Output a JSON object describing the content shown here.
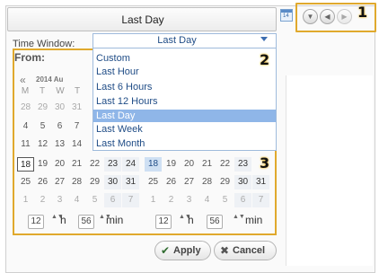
{
  "header": {
    "title": "Last Day"
  },
  "calendar_icon": {
    "label": "14"
  },
  "nav": {
    "dropdown_icon": "dropdown-icon",
    "prev_icon": "prev-icon",
    "next_icon": "next-icon"
  },
  "badges": {
    "b1": "1",
    "b2": "2",
    "b3": "3"
  },
  "time_window": {
    "label": "Time Window:",
    "value": "Last Day",
    "options": [
      "Custom",
      "Last Hour",
      "Last 6 Hours",
      "Last 12 Hours",
      "Last Day",
      "Last Week",
      "Last Month"
    ],
    "selected_index": 4
  },
  "from": {
    "label": "From:",
    "prev_label": "«",
    "month_label": "2014 Au",
    "day_names": [
      "M",
      "T",
      "W",
      "T"
    ],
    "weeks": [
      [
        "28",
        "29",
        "30",
        "31"
      ],
      [
        "4",
        "5",
        "6",
        "7"
      ],
      [
        "11",
        "12",
        "13",
        "14"
      ],
      [
        "18",
        "19",
        "20",
        "21",
        "22",
        "23",
        "24"
      ],
      [
        "25",
        "26",
        "27",
        "28",
        "29",
        "30",
        "31"
      ],
      [
        "1",
        "2",
        "3",
        "4",
        "5",
        "6",
        "7"
      ]
    ]
  },
  "to": {
    "weeks": [
      [
        "18",
        "19",
        "20",
        "21",
        "22",
        "23"
      ],
      [
        "25",
        "26",
        "27",
        "28",
        "29",
        "30",
        "31"
      ],
      [
        "1",
        "2",
        "3",
        "4",
        "5",
        "6",
        "7"
      ]
    ]
  },
  "time": {
    "from_hour": "12",
    "from_hour_unit": "h",
    "from_min": "56",
    "from_min_unit": "min",
    "to_hour": "12",
    "to_hour_unit": "h",
    "to_min": "56",
    "to_min_unit": "min",
    "updown": "▲▼"
  },
  "actions": {
    "apply": "Apply",
    "apply_icon": "✔",
    "cancel": "Cancel",
    "cancel_icon": "✖"
  },
  "colors": {
    "accent_border": "#e0a92d",
    "selection": "#8fb6e8",
    "link_text": "#1f4c86"
  }
}
